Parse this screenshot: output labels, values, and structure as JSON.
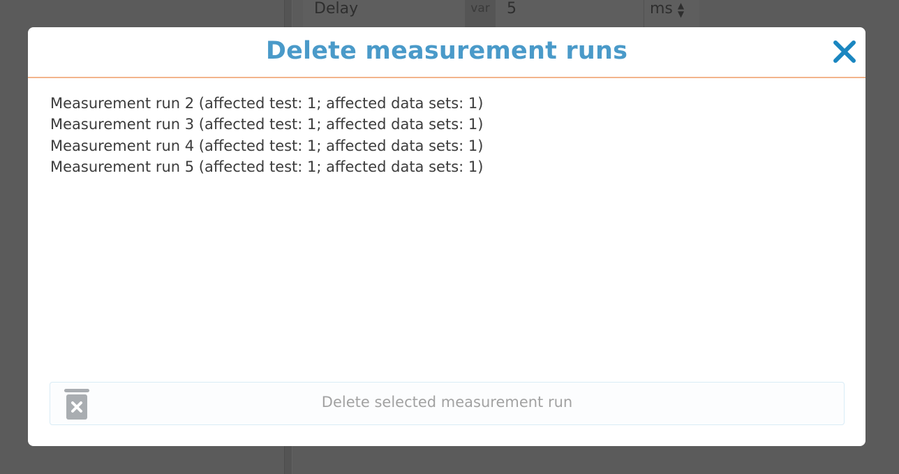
{
  "background": {
    "row_label": "Delay",
    "var_tag": "var",
    "value": "5",
    "unit": "ms"
  },
  "dialog": {
    "title": "Delete measurement runs",
    "close_icon": "close-icon",
    "items": [
      "Measurement run 2 (affected test: 1; affected data sets: 1)",
      "Measurement run 3 (affected test: 1; affected data sets: 1)",
      "Measurement run 4 (affected test: 1; affected data sets: 1)",
      "Measurement run 5 (affected test: 1; affected data sets: 1)"
    ],
    "delete_button": {
      "label": "Delete selected measurement run",
      "icon": "trash-delete-icon"
    }
  },
  "colors": {
    "title": "#4a9ac9",
    "close": "#1a86c0",
    "header_border": "#f2b48c",
    "backdrop": "#595959"
  }
}
